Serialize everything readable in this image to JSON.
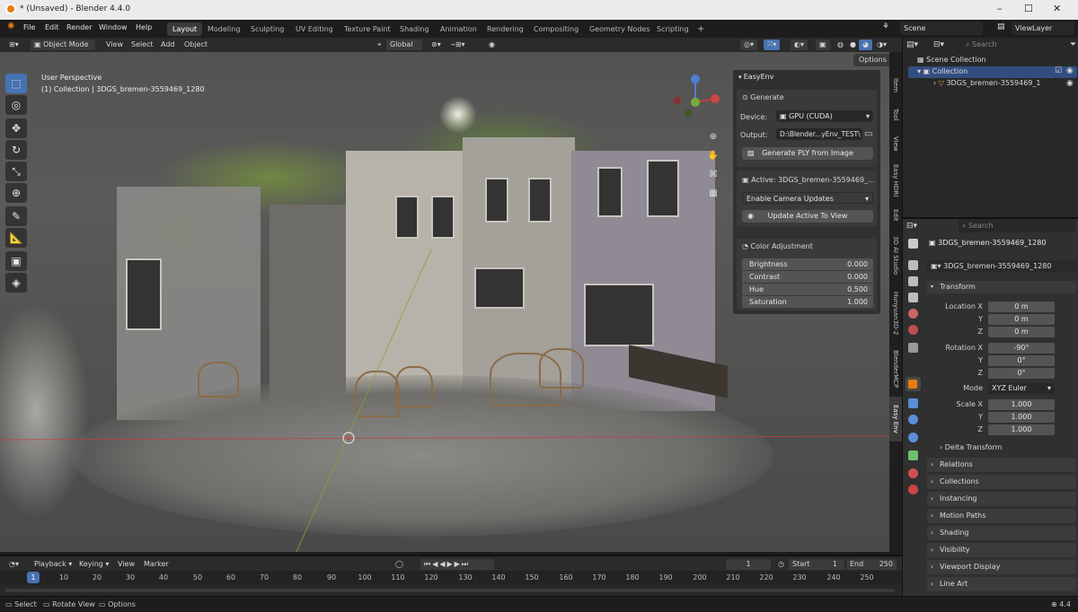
{
  "window": {
    "title": "* (Unsaved) - Blender 4.4.0",
    "minimize": "–",
    "maximize": "☐",
    "close": "✕"
  },
  "menu": [
    "File",
    "Edit",
    "Render",
    "Window",
    "Help"
  ],
  "workspaces": [
    "Layout",
    "Modeling",
    "Sculpting",
    "UV Editing",
    "Texture Paint",
    "Shading",
    "Animation",
    "Rendering",
    "Compositing",
    "Geometry Nodes",
    "Scripting"
  ],
  "workspace_add": "+",
  "scene": "Scene",
  "view_layer": "ViewLayer",
  "viewport_header": {
    "mode": "Object Mode",
    "items": [
      "View",
      "Select",
      "Add",
      "Object"
    ],
    "orientation": "Global",
    "options": "Options"
  },
  "overlay": {
    "perspective": "User Perspective",
    "collection": "(1) Collection | 3DGS_bremen-3559469_1280"
  },
  "easyenv": {
    "title": "EasyEnv",
    "generate_section": "Generate",
    "device_label": "Device:",
    "device_value": "GPU (CUDA)",
    "output_label": "Output:",
    "output_value": "D:\\Blender...yEnv_TEST\\",
    "generate_button": "Generate PLY from Image",
    "active_label": "Active: 3DGS_bremen-3559469_...",
    "camera_updates": "Enable Camera Updates",
    "update_button": "Update Active To View",
    "color_section": "Color Adjustment",
    "sliders": [
      {
        "name": "Brightness",
        "value": "0.000"
      },
      {
        "name": "Contrast",
        "value": "0.000"
      },
      {
        "name": "Hue",
        "value": "0.500"
      },
      {
        "name": "Saturation",
        "value": "1.000"
      }
    ]
  },
  "side_tabs": [
    "Item",
    "Tool",
    "View",
    "Easy HDRI",
    "Edit",
    "3D AI Studio",
    "Hunyuan3D-2",
    "BlenderMCP",
    "Easy Env"
  ],
  "outliner": {
    "search_placeholder": "Search",
    "scene_collection": "Scene Collection",
    "collection": "Collection",
    "object": "3DGS_bremen-3559469_1"
  },
  "properties": {
    "search_placeholder": "Search",
    "object_name": "3DGS_bremen-3559469_1280",
    "object_data": "3DGS_bremen-3559469_1280",
    "transform": "Transform",
    "location_label": [
      "Location X",
      "Y",
      "Z"
    ],
    "location": [
      "0 m",
      "0 m",
      "0 m"
    ],
    "rotation_label": [
      "Rotation X",
      "Y",
      "Z"
    ],
    "rotation": [
      "-90°",
      "0°",
      "0°"
    ],
    "mode_label": "Mode",
    "mode_value": "XYZ Euler",
    "scale_label": [
      "Scale X",
      "Y",
      "Z"
    ],
    "scale": [
      "1.000",
      "1.000",
      "1.000"
    ],
    "delta_transform": "Delta Transform",
    "panels": [
      "Relations",
      "Collections",
      "Instancing",
      "Motion Paths",
      "Shading",
      "Visibility",
      "Viewport Display",
      "Line Art"
    ]
  },
  "timeline": {
    "menus": [
      "Playback",
      "Keying",
      "View",
      "Marker"
    ],
    "current_frame": "1",
    "start_label": "Start",
    "start": "1",
    "end_label": "End",
    "end": "250",
    "ticks": [
      "1",
      "10",
      "20",
      "30",
      "40",
      "50",
      "60",
      "70",
      "80",
      "90",
      "100",
      "110",
      "120",
      "130",
      "140",
      "150",
      "160",
      "170",
      "180",
      "190",
      "200",
      "210",
      "220",
      "230",
      "240",
      "250"
    ]
  },
  "statusbar": {
    "select": "Select",
    "rotate_view": "Rotate View",
    "options": "Options",
    "version": "4.4"
  },
  "colors": {
    "accent": "#4772b3",
    "blender_orange": "#e87d0d",
    "x_axis": "#c83c3c",
    "y_axis": "#7aa83a"
  }
}
